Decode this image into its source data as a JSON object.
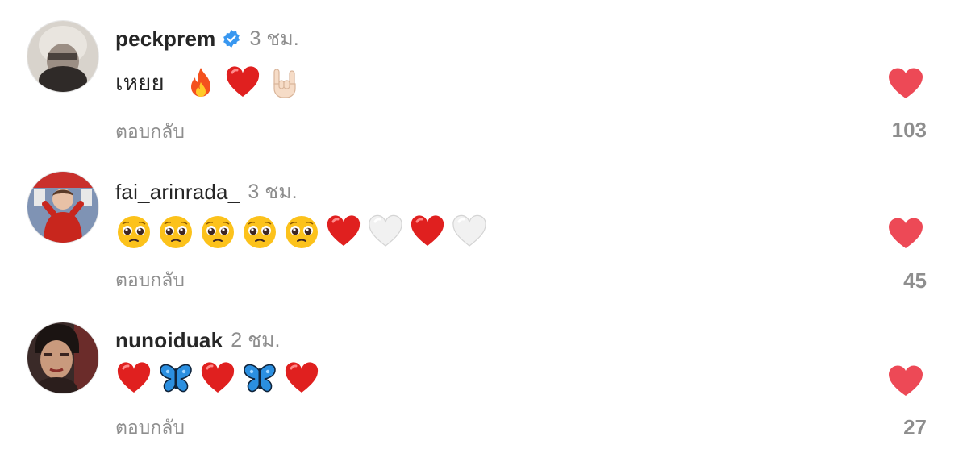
{
  "comments": [
    {
      "username": "peckprem",
      "verified": true,
      "time": "3 ชม.",
      "text": "เหยย",
      "emojis": [
        "fire-icon",
        "red-heart-icon",
        "sign-of-horns-icon"
      ],
      "reply_label": "ตอบกลับ",
      "likes": "103",
      "avatar_icon": "avatar-photo"
    },
    {
      "username": "fai_arinrada_",
      "verified": false,
      "time": "3 ชม.",
      "text": "",
      "emojis": [
        "pleading-face-icon",
        "pleading-face-icon",
        "pleading-face-icon",
        "pleading-face-icon",
        "pleading-face-icon",
        "red-heart-icon",
        "white-heart-icon",
        "red-heart-icon",
        "white-heart-icon"
      ],
      "reply_label": "ตอบกลับ",
      "likes": "45",
      "avatar_icon": "avatar-photo"
    },
    {
      "username": "nunoiduak",
      "verified": false,
      "time": "2 ชม.",
      "text": "",
      "emojis": [
        "red-heart-icon",
        "blue-butterfly-icon",
        "red-heart-icon",
        "blue-butterfly-icon",
        "red-heart-icon"
      ],
      "reply_label": "ตอบกลับ",
      "likes": "27",
      "avatar_icon": "avatar-photo"
    }
  ],
  "colors": {
    "like_red": "#ed4956",
    "verified_blue": "#3897f0",
    "secondary_text": "#8e8e8e",
    "primary_text": "#262626"
  }
}
